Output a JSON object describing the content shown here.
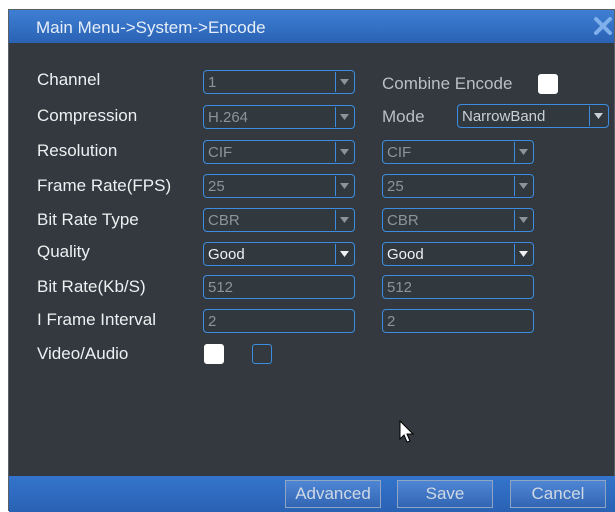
{
  "title": "Main Menu->System->Encode",
  "labels": {
    "channel": "Channel",
    "compression": "Compression",
    "resolution": "Resolution",
    "frame_rate": "Frame Rate(FPS)",
    "bit_rate_type": "Bit Rate Type",
    "quality": "Quality",
    "bit_rate": "Bit Rate(Kb/S)",
    "i_frame_interval": "I Frame Interval",
    "video_audio": "Video/Audio",
    "combine_encode": "Combine Encode",
    "mode": "Mode"
  },
  "main_stream": {
    "channel": "1",
    "compression": "H.264",
    "resolution": "CIF",
    "frame_rate": "25",
    "bit_rate_type": "CBR",
    "quality": "Good",
    "bit_rate": "512",
    "i_frame_interval": "2",
    "video_checked": true
  },
  "extra_stream": {
    "mode": "NarrowBand",
    "resolution": "CIF",
    "frame_rate": "25",
    "bit_rate_type": "CBR",
    "quality": "Good",
    "bit_rate": "512",
    "i_frame_interval": "2",
    "audio_checked": false,
    "combine_encode_checked": true
  },
  "buttons": {
    "advanced": "Advanced",
    "save": "Save",
    "cancel": "Cancel"
  },
  "colors": {
    "title_bar": "#2f6cc0",
    "panel_bg": "#33393f",
    "field_border": "#3c8de0"
  },
  "icons": {
    "close": "close-icon",
    "dropdown": "chevron-down-icon",
    "cursor": "mouse-pointer-icon"
  }
}
